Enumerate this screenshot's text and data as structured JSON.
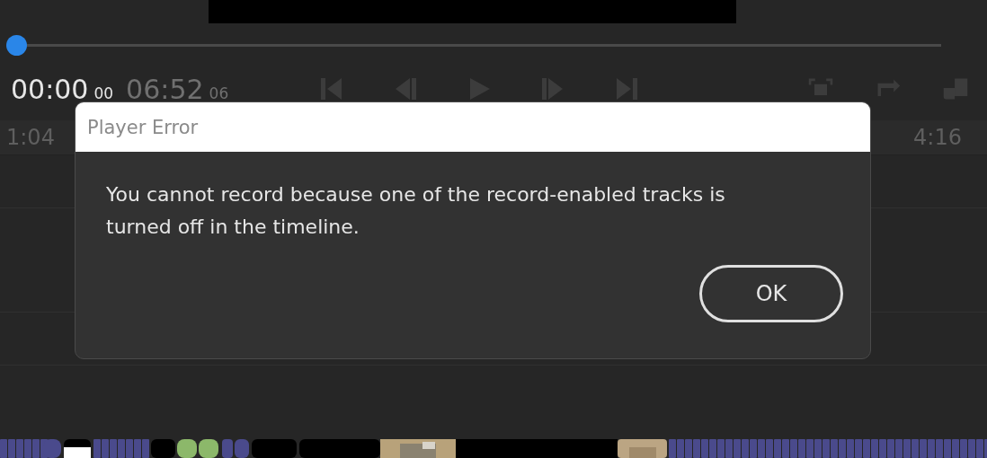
{
  "player": {
    "scrubber": {
      "level": 0
    },
    "current_time": "00:00",
    "current_frames": "00",
    "duration": "06:52",
    "duration_frames": "06"
  },
  "ruler": {
    "start": "1:04",
    "end": "4:16"
  },
  "dialog": {
    "title": "Player Error",
    "message": "You cannot record because one of the record-enabled tracks is turned off in the timeline.",
    "buttons": [
      "OK"
    ]
  }
}
